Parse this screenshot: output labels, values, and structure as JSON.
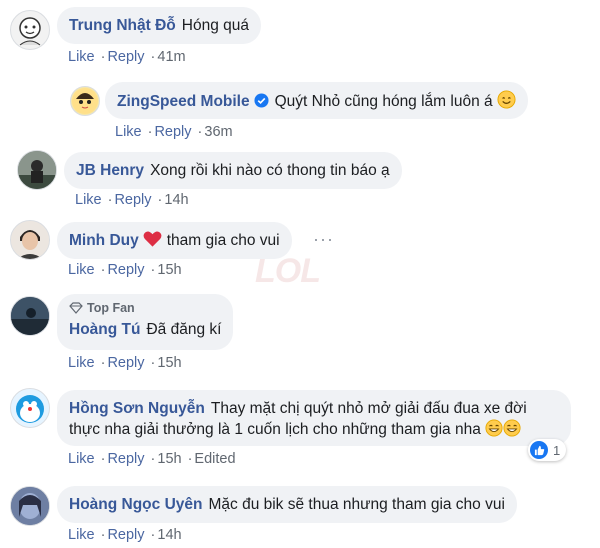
{
  "actions": {
    "like": "Like",
    "reply": "Reply",
    "edited": "Edited"
  },
  "comments": [
    {
      "author": "Trung Nhật Đỗ",
      "text": "Hóng quá",
      "time": "41m"
    },
    {
      "author": "ZingSpeed Mobile",
      "text": "Quýt Nhỏ cũng hóng lắm luôn á",
      "time": "36m",
      "verified": true,
      "emoji": "smiling-face-icon"
    },
    {
      "author": "JB Henry",
      "text": "Xong rồi khi nào có thong tin báo ạ",
      "time": "14h"
    },
    {
      "author": "Minh Duy",
      "text": "tham gia cho vui",
      "time": "15h",
      "emoji": "red-heart-icon"
    },
    {
      "author": "Hoàng Tú",
      "text": "Đã đăng kí",
      "time": "15h",
      "badge": "Top Fan"
    },
    {
      "author": "Hồng Sơn Nguyễn",
      "text_line1": "Thay mặt chị quýt nhỏ mở giải đấu đua xe đời",
      "text_line2": "thực nha giải thưởng là 1 cuốn lịch cho những tham gia nha",
      "time": "15h",
      "reaction_count": "1"
    },
    {
      "author": "Hoàng Ngọc Uyên",
      "text": "Mặc đu bik sẽ thua nhưng tham gia cho vui",
      "time": "14h"
    }
  ],
  "colors": {
    "author": "#385898",
    "bubble": "#f0f2f5",
    "meta": "#606770",
    "like_blue": "#1877f2"
  }
}
